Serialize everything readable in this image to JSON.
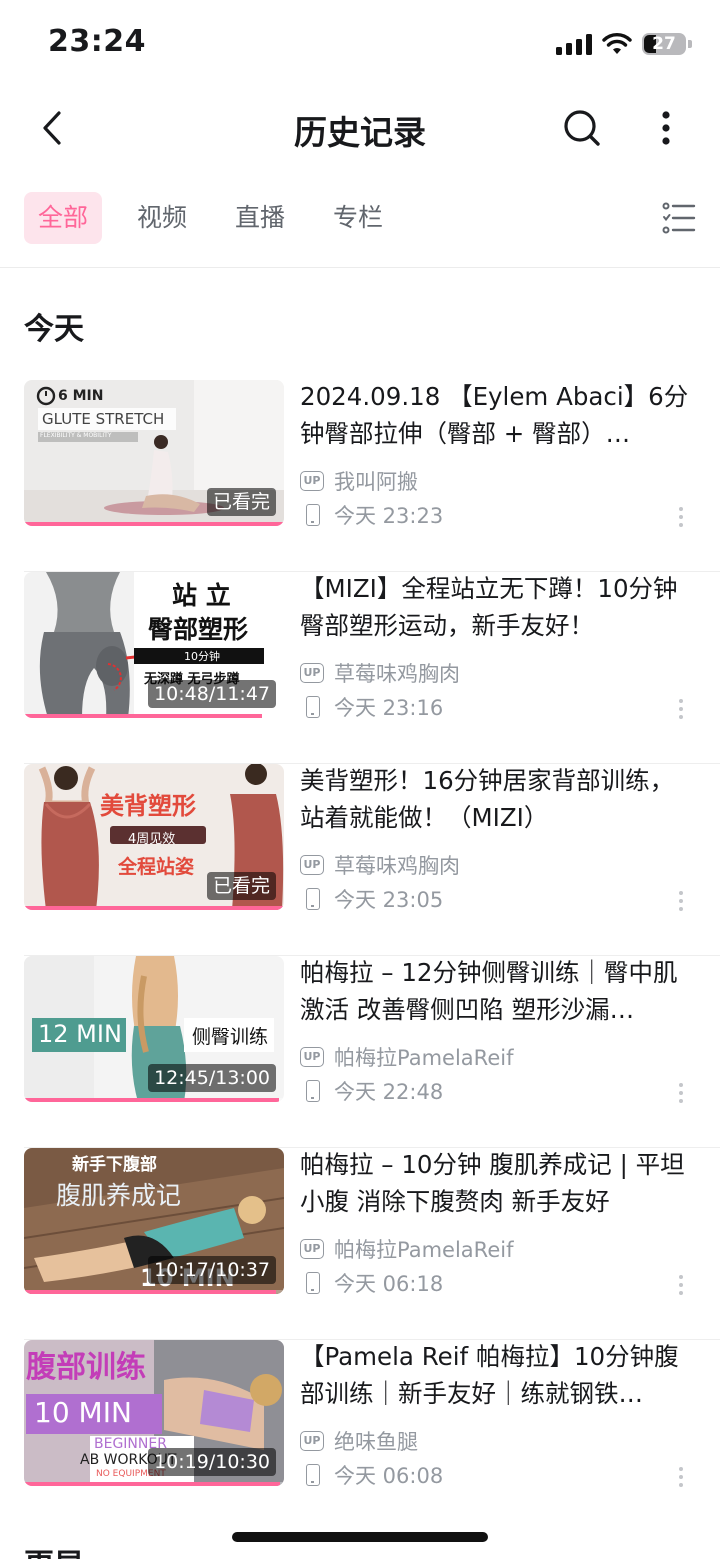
{
  "status_bar": {
    "time": "23:24",
    "battery": "27"
  },
  "nav": {
    "title": "历史记录"
  },
  "tabs": [
    {
      "label": "全部",
      "active": true
    },
    {
      "label": "视频",
      "active": false
    },
    {
      "label": "直播",
      "active": false
    },
    {
      "label": "专栏",
      "active": false
    }
  ],
  "sections": [
    {
      "title": "今天"
    },
    {
      "title": "更早"
    }
  ],
  "items": [
    {
      "title": "2024.09.18 【Eylem Abaci】6分钟臀部拉伸（臀部 + 臀部）…",
      "author": "我叫阿搬",
      "time": "今天 23:23",
      "badge": "已看完",
      "progress": 1.0,
      "thumb_text": {
        "line1": "6 MIN",
        "line2": "GLUTE STRETCH",
        "line3": "FLEXIBILITY & MOBILITY"
      }
    },
    {
      "title": "【MIZI】全程站立无下蹲！10分钟臀部塑形运动，新手友好！",
      "author": "草莓味鸡胸肉",
      "time": "今天 23:16",
      "badge": "10:48/11:47",
      "progress": 0.917,
      "thumb_text": {
        "line1": "站 立",
        "line2": "臀部塑形",
        "line3": "10分钟",
        "line4": "无深蹲 无弓步蹲"
      }
    },
    {
      "title": "美背塑形！16分钟居家背部训练，站着就能做！（MIZI）",
      "author": "草莓味鸡胸肉",
      "time": "今天 23:05",
      "badge": "已看完",
      "progress": 1.0,
      "thumb_text": {
        "line1": "美背塑形",
        "line2": "4周见效",
        "line3": "全程站姿"
      }
    },
    {
      "title": "帕梅拉 – 12分钟侧臀训练｜臀中肌激活 改善臀侧凹陷 塑形沙漏…",
      "author": "帕梅拉PamelaReif",
      "time": "今天 22:48",
      "badge": "12:45/13:00",
      "progress": 0.981,
      "thumb_text": {
        "line1": "12 MIN",
        "line2": "侧臀训练"
      }
    },
    {
      "title": "帕梅拉 – 10分钟 腹肌养成记 | 平坦小腹 消除下腹赘肉 新手友好",
      "author": "帕梅拉PamelaReif",
      "time": "今天 06:18",
      "badge": "10:17/10:37",
      "progress": 0.969,
      "thumb_text": {
        "line1": "新手下腹部",
        "line2": "腹肌养成记",
        "line3": "10 MIN"
      }
    },
    {
      "title": "【Pamela Reif 帕梅拉】10分钟腹部训练｜新手友好｜练就钢铁…",
      "author": "绝味鱼腿",
      "time": "今天 06:08",
      "badge": "10:19/10:30",
      "progress": 0.983,
      "thumb_text": {
        "line1": "腹部训练",
        "line2": "10 MIN",
        "line3": "BEGINNER",
        "line4": "AB WORKOUT",
        "line5": "NO EQUIPMENT"
      }
    }
  ],
  "colors": {
    "accent": "#ff6699",
    "accent_bg": "#fde4ec",
    "secondary_text": "#9499a0"
  }
}
